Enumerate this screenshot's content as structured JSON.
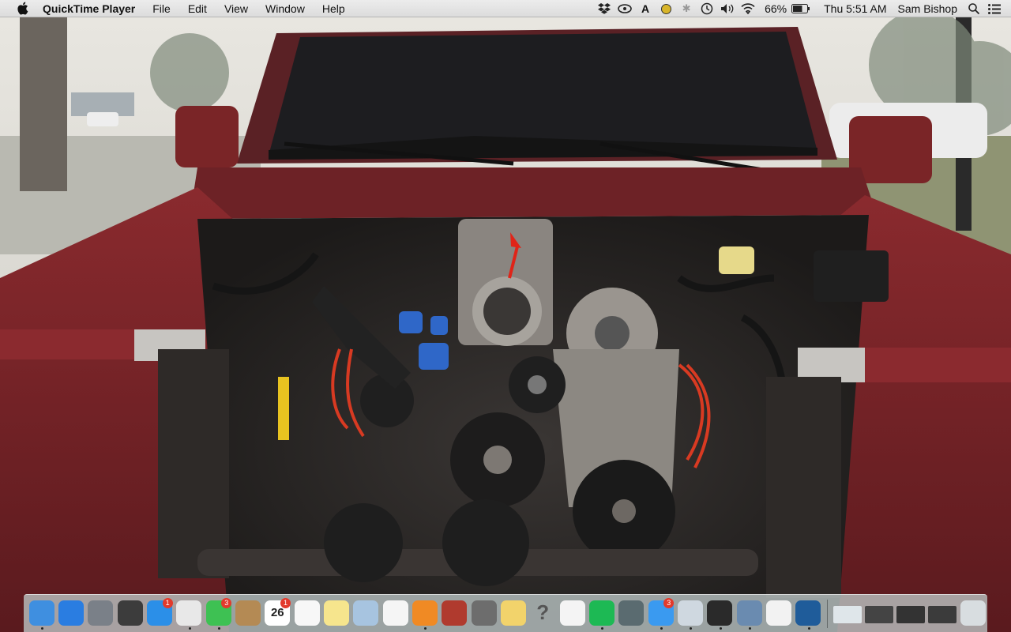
{
  "menubar": {
    "app_name": "QuickTime Player",
    "menus": [
      "File",
      "Edit",
      "View",
      "Window",
      "Help"
    ],
    "battery_percent": "66%",
    "clock": "Thu 5:51 AM",
    "user": "Sam Bishop"
  },
  "dock": {
    "items": [
      {
        "name": "finder",
        "color": "#3f8fe0"
      },
      {
        "name": "safari",
        "color": "#2a7de1"
      },
      {
        "name": "launchpad",
        "color": "#7a8088"
      },
      {
        "name": "mission-control",
        "color": "#3c3c3c"
      },
      {
        "name": "app-store",
        "color": "#2b8fe8",
        "badge": "1"
      },
      {
        "name": "chrome",
        "color": "#e8e8e8"
      },
      {
        "name": "facetime",
        "color": "#3ec153",
        "badge": "3"
      },
      {
        "name": "contacts",
        "color": "#b48a54"
      },
      {
        "name": "calendar",
        "color": "#ffffff",
        "badge": "1",
        "label": "26"
      },
      {
        "name": "reminders",
        "color": "#f7f7f7"
      },
      {
        "name": "notes",
        "color": "#f6e58d"
      },
      {
        "name": "preview",
        "color": "#a7c4e0"
      },
      {
        "name": "photos",
        "color": "#f5f5f5"
      },
      {
        "name": "ibooks",
        "color": "#f08a24"
      },
      {
        "name": "photo-booth",
        "color": "#b03a2e"
      },
      {
        "name": "system-preferences",
        "color": "#6d6d6d"
      },
      {
        "name": "stickies",
        "color": "#f2d36b"
      },
      {
        "name": "help",
        "color": "transparent",
        "label": "?"
      },
      {
        "name": "textedit",
        "color": "#f4f4f4"
      },
      {
        "name": "spotify",
        "color": "#1db954"
      },
      {
        "name": "utility",
        "color": "#5a6b70"
      },
      {
        "name": "messages",
        "color": "#3a9af0",
        "badge": "3"
      },
      {
        "name": "mail",
        "color": "#cfd8e0"
      },
      {
        "name": "final-cut-pro",
        "color": "#2a2a2a"
      },
      {
        "name": "xcode",
        "color": "#6a8bb0"
      },
      {
        "name": "itunes",
        "color": "#f2f2f2"
      },
      {
        "name": "quicktime",
        "color": "#1f5c9a"
      }
    ],
    "docs": [
      {
        "name": "doc-1",
        "color": "#dfe6ea"
      },
      {
        "name": "doc-2",
        "color": "#444444"
      },
      {
        "name": "doc-3",
        "color": "#333333"
      },
      {
        "name": "doc-4",
        "color": "#3b3b3b"
      }
    ],
    "trash": {
      "name": "trash",
      "color": "#d8dde0"
    }
  }
}
